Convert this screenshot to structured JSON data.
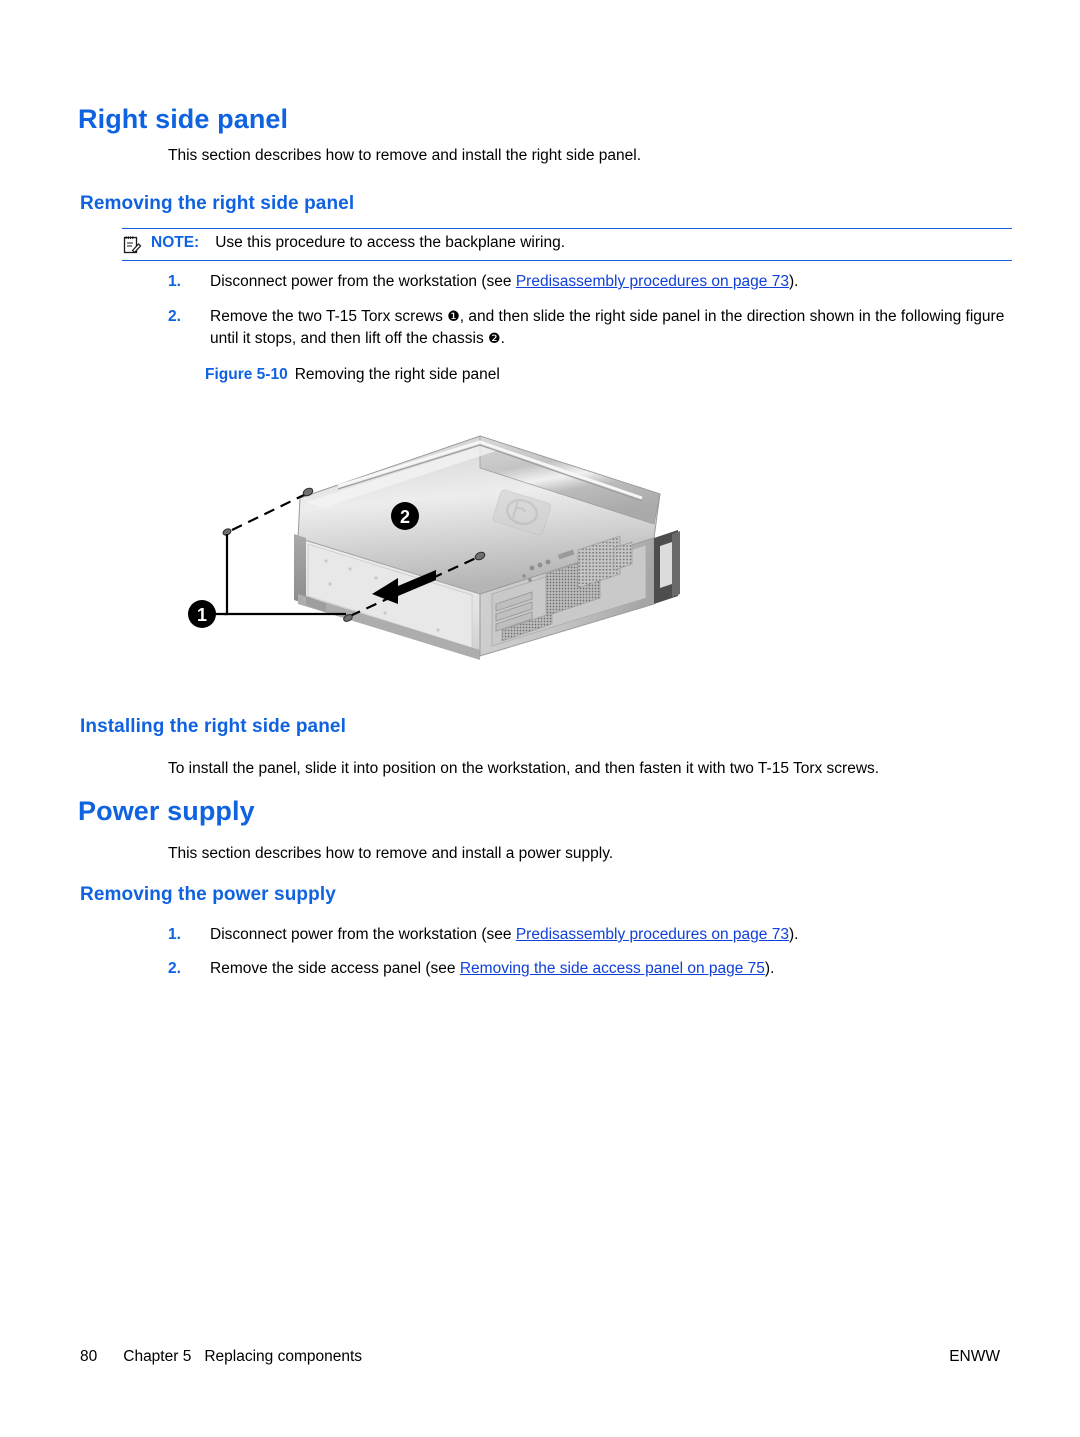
{
  "document": {
    "sections": [
      {
        "id": "right-side-panel",
        "heading": "Right side panel",
        "intro": "This section describes how to remove and install the right side panel."
      },
      {
        "id": "power-supply",
        "heading": "Power supply",
        "intro": "This section describes how to remove and install a power supply."
      }
    ],
    "subheadings": {
      "removing_right_side_panel": "Removing the right side panel",
      "installing_right_side_panel": "Installing the right side panel",
      "removing_power_supply": "Removing the power supply"
    },
    "note": {
      "icon": "note-clipboard-pencil-icon",
      "label": "NOTE:",
      "text": "Use this procedure to access the backplane wiring."
    },
    "removal_steps": [
      {
        "number": "1.",
        "text_before_link": "Disconnect power from the workstation (see ",
        "link": "Predisassembly procedures on page 73",
        "text_after_link": ")."
      },
      {
        "number": "2.",
        "line1_part1": "Remove the two T-15 Torx screws ",
        "callout1": "❶",
        "line1_part2": ", and then slide the right side panel in the direction shown in",
        "line2_part1": "the following figure until it stops, and then lift off the chassis ",
        "callout2": "❷",
        "line2_part2": "."
      }
    ],
    "figure": {
      "label": "Figure 5-10",
      "caption": "Removing the right side panel",
      "alt": "Removing the right side panel",
      "callouts": [
        {
          "id": "1",
          "label": "1",
          "meaning": "two T-15 Torx screws"
        },
        {
          "id": "2",
          "label": "2",
          "meaning": "slide direction and lift off chassis"
        }
      ]
    },
    "installing_text": "To install the panel, slide it into position on the workstation, and then fasten it with two T-15 Torx screws.",
    "power_supply_steps": [
      {
        "number": "1.",
        "text_before_link": "Disconnect power from the workstation (see ",
        "link": "Predisassembly procedures on page 73",
        "text_after_link": ")."
      },
      {
        "number": "2.",
        "text_before_link": "Remove the side access panel (see ",
        "link": "Removing the side access panel on page 75",
        "text_after_link": ")."
      }
    ],
    "footer": {
      "page_number": "80",
      "chapter": "Chapter 5",
      "chapter_title": "Replacing components",
      "locale": "ENWW"
    },
    "colors": {
      "heading_blue": "#0f62e0",
      "link_blue": "#1040d8",
      "text_black": "#000000",
      "page_background": "#ffffff"
    }
  }
}
